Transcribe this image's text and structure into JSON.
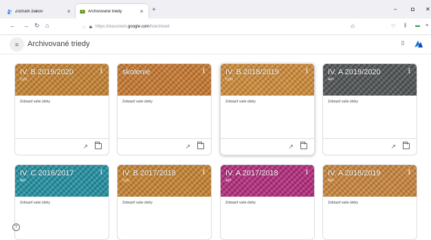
{
  "browser": {
    "tabs": [
      {
        "title": "Zoznam žiakov",
        "icon": "people-icon"
      },
      {
        "title": "Archivované triedy",
        "icon": "classroom-icon"
      }
    ],
    "new_tab": "+",
    "url_prefix": "https://classroom.",
    "url_domain": "google.com",
    "url_suffix": "/h/archived",
    "win_min": "–",
    "win_max": "◘",
    "win_close": "✕"
  },
  "header": {
    "title": "Archivované triedy",
    "menu_icon": "≡",
    "apps_icon": "⠿"
  },
  "cards": [
    {
      "title": "IV. B 2019/2020",
      "subtitle": "CVU",
      "color": "#c6822f",
      "link": "Zobraziť vaše úlohy"
    },
    {
      "title": "skolenie",
      "subtitle": "",
      "color": "#c7772d",
      "link": "Zobraziť vaše úlohy"
    },
    {
      "title": "IV. B 2018/2019",
      "subtitle": "CVU",
      "color": "#cf8a36",
      "link": "Zobraziť vaše úlohy"
    },
    {
      "title": "IV. A 2019/2020",
      "subtitle": "API",
      "color": "#4e5152",
      "link": "Zobraziť vaše úlohy"
    },
    {
      "title": "IV. C 2016/2017",
      "subtitle": "API",
      "color": "#1f8fa0",
      "link": "Zobraziť vaše úlohy"
    },
    {
      "title": "IV. B 2017/2018",
      "subtitle": "CVU",
      "color": "#c6822f",
      "link": "Zobraziť vaše úlohy"
    },
    {
      "title": "IV. A 2017/2018",
      "subtitle": "API",
      "color": "#b2287a",
      "link": "Zobraziť vaše úlohy"
    },
    {
      "title": "IV. A 2018/2019",
      "subtitle": "API",
      "color": "#c9843a",
      "link": "Zobraziť vaše úlohy"
    }
  ],
  "help_label": "?"
}
